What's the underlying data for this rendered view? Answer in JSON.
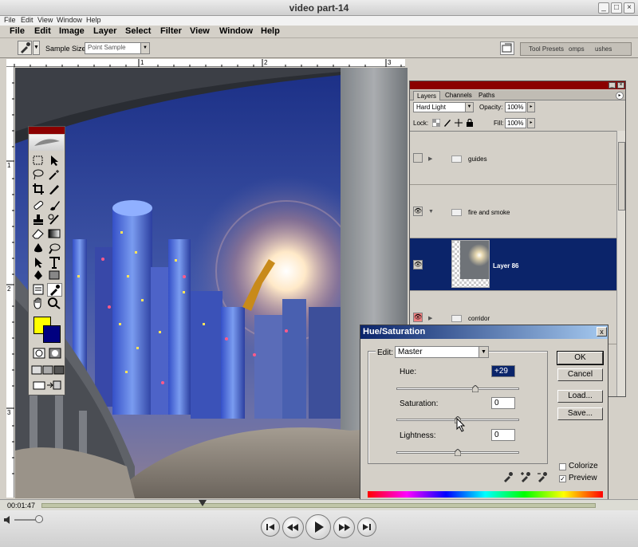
{
  "player": {
    "title": "video part-14",
    "window_controls": {
      "minimize": "_",
      "maximize": "□",
      "close": "×"
    },
    "menu": [
      "File",
      "Edit",
      "View",
      "Window",
      "Help"
    ],
    "current_time": "00:01:47",
    "playback_progress": 0.29
  },
  "photoshop": {
    "menu": [
      "File",
      "Edit",
      "Image",
      "Layer",
      "Select",
      "Filter",
      "View",
      "Window",
      "Help"
    ],
    "options_bar": {
      "sample_size_label": "Sample Size:",
      "sample_size_value": "Point Sample",
      "palette_well_tabs": [
        "Tool Presets",
        "omps",
        "ushes"
      ]
    },
    "rulers": {
      "top": [
        "1",
        "2",
        "3"
      ],
      "left": [
        "1",
        "2",
        "3"
      ]
    },
    "colors": {
      "foreground": "#ffff00",
      "background": "#000080",
      "selection": "#0b246a",
      "titlebar": "#8b0000"
    }
  },
  "layers_palette": {
    "tabs": [
      "Layers",
      "Channels",
      "Paths"
    ],
    "blend_mode": "Hard Light",
    "opacity_label": "Opacity:",
    "opacity": "100%",
    "lock_label": "Lock:",
    "fill_label": "Fill:",
    "fill": "100%",
    "layers": [
      {
        "name": "guides",
        "visible": false,
        "type": "group"
      },
      {
        "name": "fire and smoke",
        "visible": true,
        "type": "group"
      },
      {
        "name": "Layer 86",
        "visible": true,
        "type": "layer",
        "selected": true
      },
      {
        "name": "corridor",
        "visible": true,
        "type": "group"
      }
    ]
  },
  "hue_saturation": {
    "title": "Hue/Saturation",
    "close_label": "x",
    "edit_label": "Edit:",
    "edit_value": "Master",
    "hue_label": "Hue:",
    "hue_value": "+29",
    "hue_position": 0.64,
    "saturation_label": "Saturation:",
    "saturation_value": "0",
    "saturation_position": 0.5,
    "lightness_label": "Lightness:",
    "lightness_value": "0",
    "lightness_position": 0.5,
    "buttons": {
      "ok": "OK",
      "cancel": "Cancel",
      "load": "Load...",
      "save": "Save..."
    },
    "colorize_label": "Colorize",
    "colorize_checked": false,
    "preview_label": "Preview",
    "preview_checked": true
  }
}
